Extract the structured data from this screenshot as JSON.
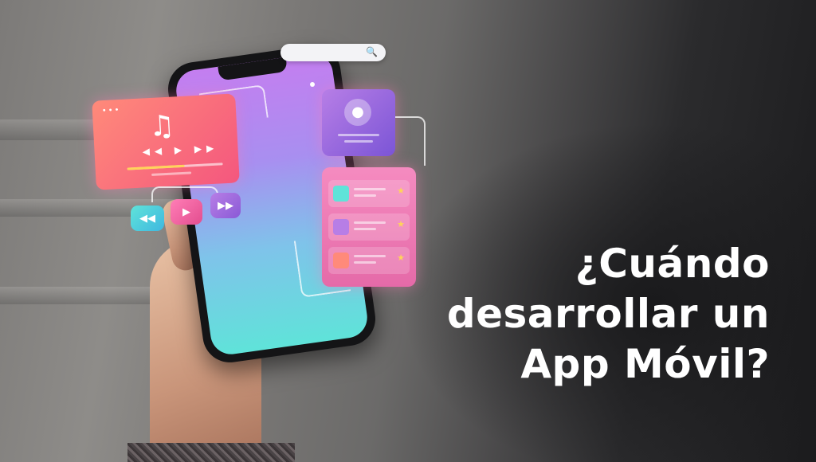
{
  "headline": {
    "line1": "¿Cuándo",
    "line2": "desarrollar un",
    "line3": "App Móvil?"
  },
  "colors": {
    "text": "#ffffff",
    "screen_top": "#c47ef0",
    "screen_bottom": "#5fe3d9",
    "music_card": "#f4577e",
    "profile_card": "#7b55d6",
    "list_card": "#e56aa8"
  },
  "icons": {
    "search": "search-icon",
    "music": "music-note-icon",
    "rewind": "rewind-icon",
    "play": "play-icon",
    "forward": "fast-forward-icon",
    "profile": "user-icon",
    "star": "star-icon"
  }
}
